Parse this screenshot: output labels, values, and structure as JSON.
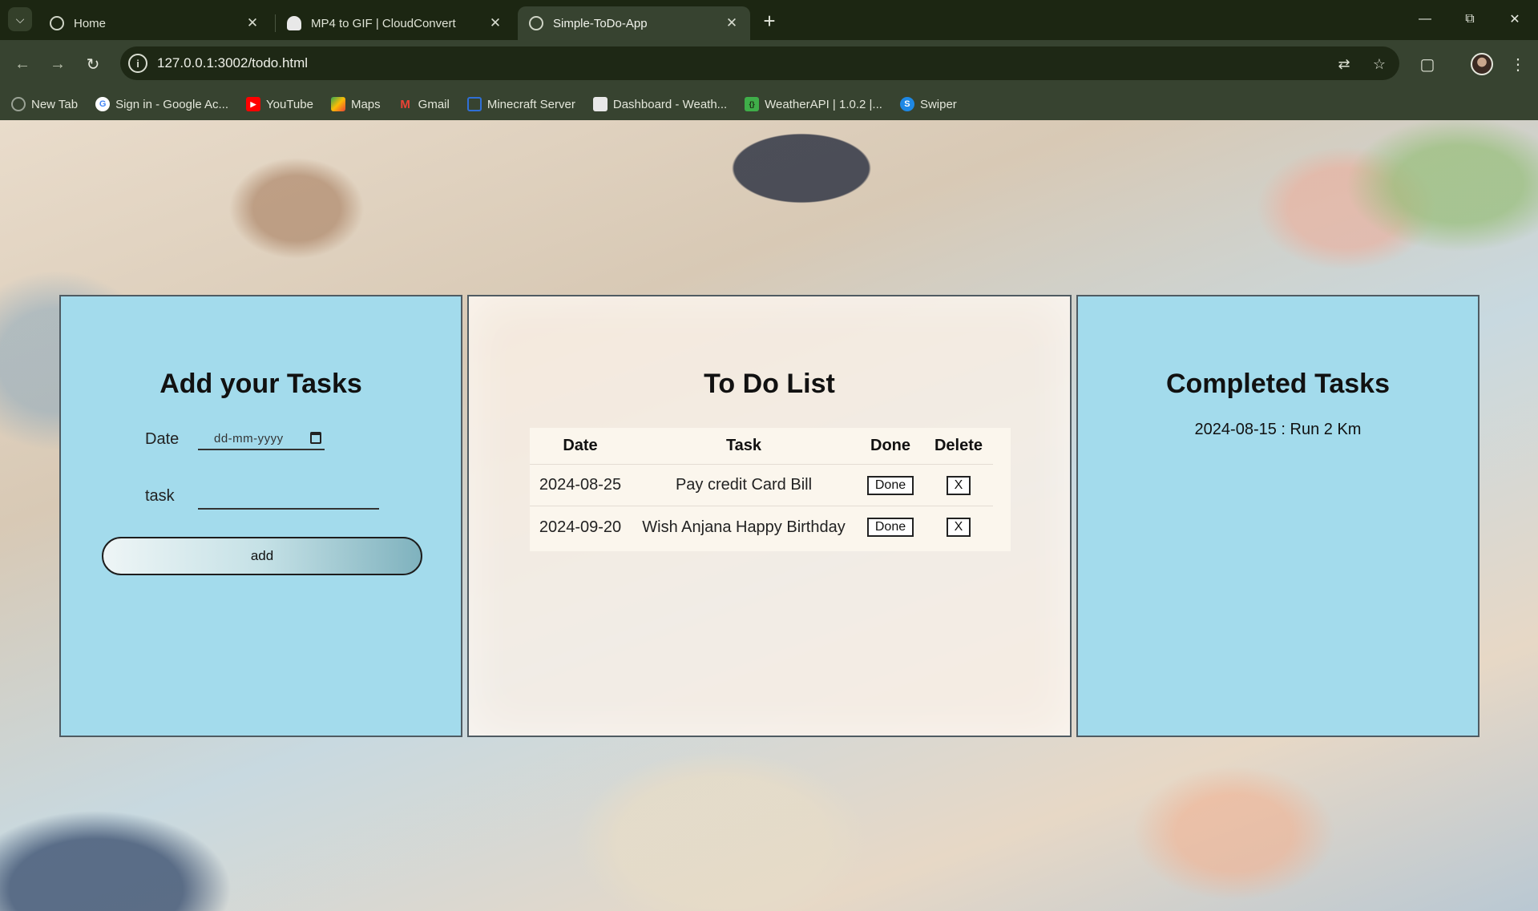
{
  "browser": {
    "tabs": [
      {
        "label": "Home"
      },
      {
        "label": "MP4 to GIF | CloudConvert"
      },
      {
        "label": "Simple-ToDo-App"
      }
    ],
    "url": "127.0.0.1:3002/todo.html",
    "bookmarks": [
      {
        "label": "New Tab",
        "icon": "globe-icon",
        "color": "#9aa295"
      },
      {
        "label": "Sign in - Google Ac...",
        "icon": "google-icon",
        "color": "#4285f4"
      },
      {
        "label": "YouTube",
        "icon": "youtube-icon",
        "color": "#ff0000"
      },
      {
        "label": "Maps",
        "icon": "maps-icon",
        "color": "#34a853"
      },
      {
        "label": "Gmail",
        "icon": "gmail-icon",
        "color": "#ea4335"
      },
      {
        "label": "Minecraft Server",
        "icon": "minecraft-icon",
        "color": "#2f6fd6"
      },
      {
        "label": "Dashboard - Weath...",
        "icon": "page-icon",
        "color": "#e8e8e8"
      },
      {
        "label": "WeatherAPI | 1.0.2 |...",
        "icon": "api-icon",
        "color": "#3fae49"
      },
      {
        "label": "Swiper",
        "icon": "swiper-icon",
        "color": "#1e88e5"
      }
    ]
  },
  "add_panel": {
    "title": "Add your Tasks",
    "date_label": "Date",
    "date_placeholder": "dd-mm-yyyy",
    "task_label": "task",
    "task_value": "",
    "add_label": "add"
  },
  "todo_panel": {
    "title": "To Do List",
    "headers": {
      "date": "Date",
      "task": "Task",
      "done": "Done",
      "delete": "Delete"
    },
    "rows": [
      {
        "date": "2024-08-25",
        "task": "Pay credit Card Bill",
        "done_label": "Done",
        "delete_label": "X"
      },
      {
        "date": "2024-09-20",
        "task": "Wish Anjana Happy Birthday",
        "done_label": "Done",
        "delete_label": "X"
      }
    ]
  },
  "completed_panel": {
    "title": "Completed Tasks",
    "items": [
      "2024-08-15 : Run 2 Km"
    ]
  },
  "colors": {
    "panel_blue": "#a3dbec",
    "chrome_bg": "#374330",
    "tabstrip_bg": "#1c2612"
  }
}
